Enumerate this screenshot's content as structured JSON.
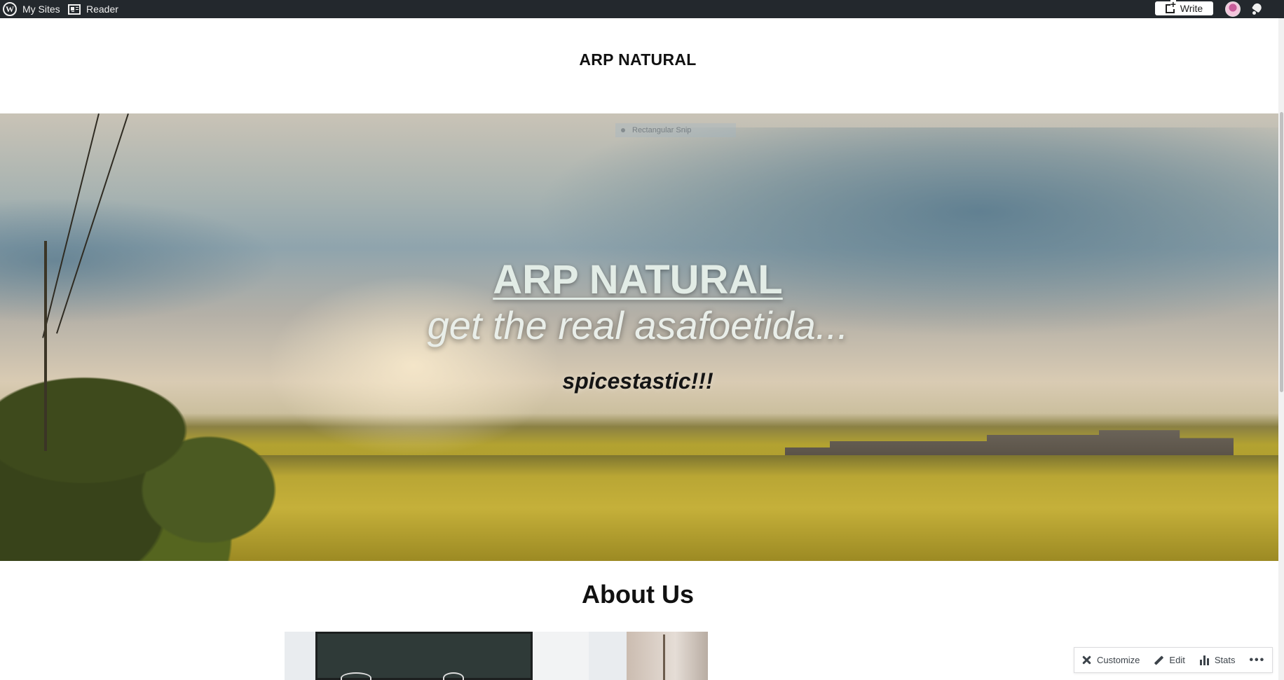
{
  "adminbar": {
    "my_sites_label": "My Sites",
    "reader_label": "Reader",
    "write_label": "Write",
    "icons": [
      "wordpress-logo-icon",
      "reader-icon",
      "write-icon",
      "avatar",
      "notifications-icon"
    ]
  },
  "site": {
    "title": "ARP NATURAL"
  },
  "hero": {
    "title": "ARP NATURAL",
    "tagline": "get the real asafoetida...",
    "subtitle": "spicestastic!!!",
    "overlay_label": "Rectangular Snip"
  },
  "about": {
    "heading": "About Us"
  },
  "actionbar": {
    "customize_label": "Customize",
    "edit_label": "Edit",
    "stats_label": "Stats",
    "more_label": "•••"
  },
  "colors": {
    "adminbar_bg": "#23282d",
    "hero_title": "#e2ece6",
    "page_bg": "#ffffff"
  }
}
